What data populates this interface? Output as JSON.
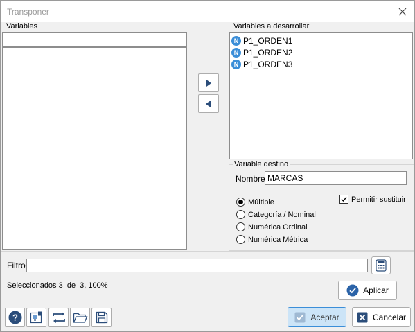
{
  "dialog": {
    "title": "Transponer",
    "close_icon": "close-icon"
  },
  "variables": {
    "label": "Variables",
    "search_value": "",
    "items": []
  },
  "desarrollar": {
    "label": "Variables a desarrollar",
    "items": [
      {
        "badge": "N",
        "label": "P1_ORDEN1"
      },
      {
        "badge": "N",
        "label": "P1_ORDEN2"
      },
      {
        "badge": "N",
        "label": "P1_ORDEN3"
      }
    ]
  },
  "move_buttons": {
    "right_icon": "arrow-right-icon",
    "left_icon": "arrow-left-icon"
  },
  "destino": {
    "label": "Variable destino",
    "nombre_label": "Nombre",
    "nombre_value": "MARCAS",
    "permitir_label": "Permitir sustituir",
    "permitir_checked": true,
    "options": [
      {
        "label": "Múltiple",
        "selected": true
      },
      {
        "label": "Categoría / Nominal",
        "selected": false
      },
      {
        "label": "Numérica Ordinal",
        "selected": false
      },
      {
        "label": "Numérica Métrica",
        "selected": false
      }
    ]
  },
  "filtro": {
    "label": "Filtro",
    "value": "",
    "calc_icon": "calculator-icon"
  },
  "status": {
    "text": "Seleccionados 3  de  3, 100%"
  },
  "buttons": {
    "aplicar": "Aplicar",
    "aceptar": "Aceptar",
    "cancelar": "Cancelar"
  },
  "toolbar": [
    "help-icon",
    "variable-picker-icon",
    "refresh-icon",
    "open-folder-icon",
    "save-icon"
  ],
  "colors": {
    "accent": "#3b8ed8",
    "aceptar_bg": "#cce4f7",
    "aceptar_border": "#3b8ed8",
    "cancel_icon_bg": "#2b4d7a"
  }
}
